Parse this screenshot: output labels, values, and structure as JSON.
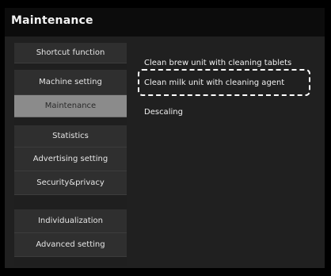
{
  "window": {
    "title": "Maintenance"
  },
  "sidebar": {
    "items": [
      {
        "label": "Shortcut function",
        "selected": false
      },
      {
        "label": "Machine setting",
        "selected": false
      },
      {
        "label": "Maintenance",
        "selected": true
      },
      {
        "label": "Statistics",
        "selected": false
      },
      {
        "label": "Advertising setting",
        "selected": false
      },
      {
        "label": "Security&privacy",
        "selected": false
      },
      {
        "label": "Individualization",
        "selected": false
      },
      {
        "label": "Advanced setting",
        "selected": false
      }
    ]
  },
  "main": {
    "items": [
      {
        "label": "Clean brew unit with cleaning tablets"
      },
      {
        "label": "Clean milk unit with cleaning agent"
      },
      {
        "label": "Descaling"
      }
    ]
  }
}
